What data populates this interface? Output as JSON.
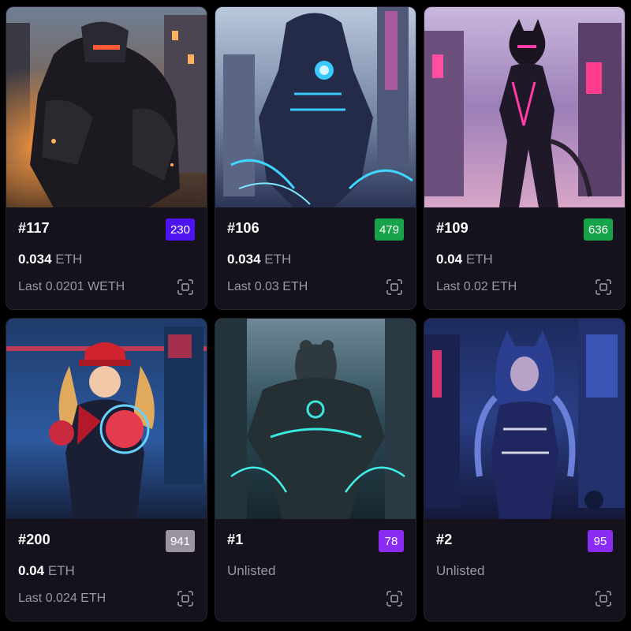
{
  "currency": "ETH",
  "colors": {
    "card_bg": "#15121d",
    "rank_indigo": "#4e14f0",
    "rank_green": "#16a34a",
    "rank_gray": "#9a93a0",
    "rank_purple": "#8b2cf5"
  },
  "cards": [
    {
      "name": "#117",
      "rank": "230",
      "rank_color": "#4e14f0",
      "price_amount": "0.034",
      "price_currency": "ETH",
      "last": "Last 0.0201 WETH",
      "status": "listed",
      "art": "armored-mech-warrior-city-night"
    },
    {
      "name": "#106",
      "rank": "479",
      "rank_color": "#16a34a",
      "price_amount": "0.034",
      "price_currency": "ETH",
      "last": "Last 0.03 ETH",
      "status": "listed",
      "art": "dark-cloaked-hero-blue-glow"
    },
    {
      "name": "#109",
      "rank": "636",
      "rank_color": "#16a34a",
      "price_amount": "0.04",
      "price_currency": "ETH",
      "last": "Last 0.02 ETH",
      "status": "listed",
      "art": "cat-helmet-heroine-pink-neon"
    },
    {
      "name": "#200",
      "rank": "941",
      "rank_color": "#9a93a0",
      "price_amount": "0.04",
      "price_currency": "ETH",
      "last": "Last 0.024 ETH",
      "status": "listed",
      "art": "red-cap-girl-power-fist"
    },
    {
      "name": "#1",
      "rank": "78",
      "rank_color": "#8b2cf5",
      "price_amount": "Unlisted",
      "price_currency": "",
      "last": "",
      "status": "unlisted",
      "art": "bear-brute-teal-aura"
    },
    {
      "name": "#2",
      "rank": "95",
      "rank_color": "#8b2cf5",
      "price_amount": "Unlisted",
      "price_currency": "",
      "last": "",
      "status": "unlisted",
      "art": "hooded-cat-girl-blue-neon"
    }
  ]
}
